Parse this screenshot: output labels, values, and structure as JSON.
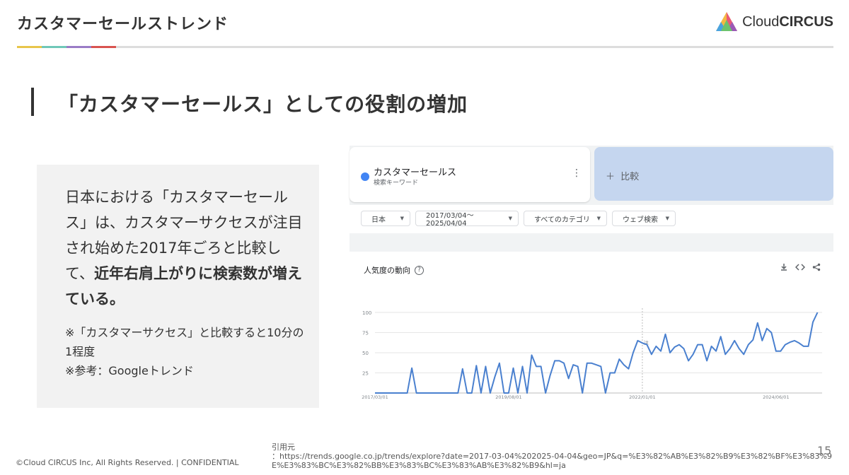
{
  "header": {
    "title": "カスタマーセールストレンド",
    "logo_text_regular": "Cloud",
    "logo_text_bold": "CIRCUS",
    "accent_colors": [
      "#e8c54a",
      "#6fc8b8",
      "#9a7cc6",
      "#d9534f"
    ]
  },
  "section": {
    "title": "「カスタマーセールス」としての役割の増加"
  },
  "textbox": {
    "main_text_1": "日本における「カスタマーセールス」は、カスタマーサクセスが注目され始めた2017年ごろと比較して、",
    "main_text_bold": "近年右肩上がりに検索数が増えている。",
    "note_1": "※「カスタマーサクセス」と比較すると10分の1程度",
    "note_2": "※参考：Googleトレンド"
  },
  "trends": {
    "term_name": "カスタマーセールス",
    "term_sub": "検索キーワード",
    "compare_label": "比較",
    "filters": [
      "日本",
      "2017/03/04～2025/04/04",
      "すべてのカテゴリ",
      "ウェブ検索"
    ],
    "chart_title": "人気度の動向",
    "series_color": "#4a80cf",
    "icons": [
      "help-icon",
      "download-icon",
      "embed-icon",
      "share-icon",
      "more-vert-icon",
      "plus-icon"
    ]
  },
  "chart_data": {
    "type": "line",
    "title": "人気度の動向",
    "xlabel": "",
    "ylabel": "",
    "ylim": [
      0,
      100
    ],
    "yticks": [
      25,
      50,
      75,
      100
    ],
    "x_range": [
      "2017/03/01",
      "2025/04/01"
    ],
    "x_ticks": [
      "2017/03/01",
      "2019/08/01",
      "2022/01/01",
      "2024/06/01"
    ],
    "grid": true,
    "annotation": {
      "label": "注",
      "at": "2022/01/01"
    },
    "series": [
      {
        "points": [
          [
            "2017/03/01",
            0
          ],
          [
            "2017/05/01",
            0
          ],
          [
            "2017/07/01",
            0
          ],
          [
            "2017/09/01",
            0
          ],
          [
            "2017/10/01",
            0
          ],
          [
            "2017/11/01",
            31
          ],
          [
            "2017/12/01",
            0
          ],
          [
            "2018/02/01",
            0
          ],
          [
            "2018/04/01",
            0
          ],
          [
            "2018/06/01",
            0
          ],
          [
            "2018/08/01",
            0
          ],
          [
            "2018/09/01",
            0
          ],
          [
            "2018/10/01",
            30
          ],
          [
            "2018/11/01",
            0
          ],
          [
            "2018/12/01",
            0
          ],
          [
            "2019/01/01",
            34
          ],
          [
            "2019/02/01",
            0
          ],
          [
            "2019/03/01",
            33
          ],
          [
            "2019/04/01",
            0
          ],
          [
            "2019/05/01",
            20
          ],
          [
            "2019/06/01",
            37
          ],
          [
            "2019/07/01",
            0
          ],
          [
            "2019/08/01",
            0
          ],
          [
            "2019/09/01",
            31
          ],
          [
            "2019/10/01",
            0
          ],
          [
            "2019/11/01",
            33
          ],
          [
            "2019/12/01",
            0
          ],
          [
            "2020/01/01",
            47
          ],
          [
            "2020/02/01",
            33
          ],
          [
            "2020/03/01",
            33
          ],
          [
            "2020/04/01",
            0
          ],
          [
            "2020/05/01",
            22
          ],
          [
            "2020/06/01",
            40
          ],
          [
            "2020/07/01",
            40
          ],
          [
            "2020/08/01",
            37
          ],
          [
            "2020/09/01",
            18
          ],
          [
            "2020/10/01",
            35
          ],
          [
            "2020/11/01",
            33
          ],
          [
            "2020/12/01",
            0
          ],
          [
            "2021/01/01",
            37
          ],
          [
            "2021/02/01",
            37
          ],
          [
            "2021/03/01",
            35
          ],
          [
            "2021/04/01",
            33
          ],
          [
            "2021/05/01",
            0
          ],
          [
            "2021/06/01",
            25
          ],
          [
            "2021/07/01",
            25
          ],
          [
            "2021/08/01",
            42
          ],
          [
            "2021/09/01",
            35
          ],
          [
            "2021/10/01",
            30
          ],
          [
            "2021/11/01",
            50
          ],
          [
            "2021/12/01",
            65
          ],
          [
            "2022/01/01",
            62
          ],
          [
            "2022/02/01",
            60
          ],
          [
            "2022/03/01",
            48
          ],
          [
            "2022/04/01",
            58
          ],
          [
            "2022/05/01",
            52
          ],
          [
            "2022/06/01",
            73
          ],
          [
            "2022/07/01",
            50
          ],
          [
            "2022/08/01",
            57
          ],
          [
            "2022/09/01",
            60
          ],
          [
            "2022/10/01",
            55
          ],
          [
            "2022/11/01",
            40
          ],
          [
            "2022/12/01",
            48
          ],
          [
            "2023/01/01",
            60
          ],
          [
            "2023/02/01",
            60
          ],
          [
            "2023/03/01",
            40
          ],
          [
            "2023/04/01",
            58
          ],
          [
            "2023/05/01",
            52
          ],
          [
            "2023/06/01",
            70
          ],
          [
            "2023/07/01",
            48
          ],
          [
            "2023/08/01",
            55
          ],
          [
            "2023/09/01",
            65
          ],
          [
            "2023/10/01",
            55
          ],
          [
            "2023/11/01",
            48
          ],
          [
            "2023/12/01",
            60
          ],
          [
            "2024/01/01",
            66
          ],
          [
            "2024/02/01",
            87
          ],
          [
            "2024/03/01",
            65
          ],
          [
            "2024/04/01",
            80
          ],
          [
            "2024/05/01",
            75
          ],
          [
            "2024/06/01",
            52
          ],
          [
            "2024/07/01",
            52
          ],
          [
            "2024/08/01",
            60
          ],
          [
            "2024/09/01",
            63
          ],
          [
            "2024/10/01",
            65
          ],
          [
            "2024/11/01",
            62
          ],
          [
            "2024/12/01",
            58
          ],
          [
            "2025/01/01",
            58
          ],
          [
            "2025/02/01",
            88
          ],
          [
            "2025/03/01",
            100
          ]
        ]
      }
    ]
  },
  "footer": {
    "copyright": "©Cloud CIRCUS Inc, All Rights Reserved. | CONFIDENTIAL",
    "citation_label": "引用元",
    "citation_url": "：https://trends.google.co.jp/trends/explore?date=2017-03-04%202025-04-04&geo=JP&q=%E3%82%AB%E3%82%B9%E3%82%BF%E3%83%9E%E3%83%BC%E3%82%BB%E3%83%BC%E3%83%AB%E3%82%B9&hl=ja",
    "page_number": "15"
  }
}
